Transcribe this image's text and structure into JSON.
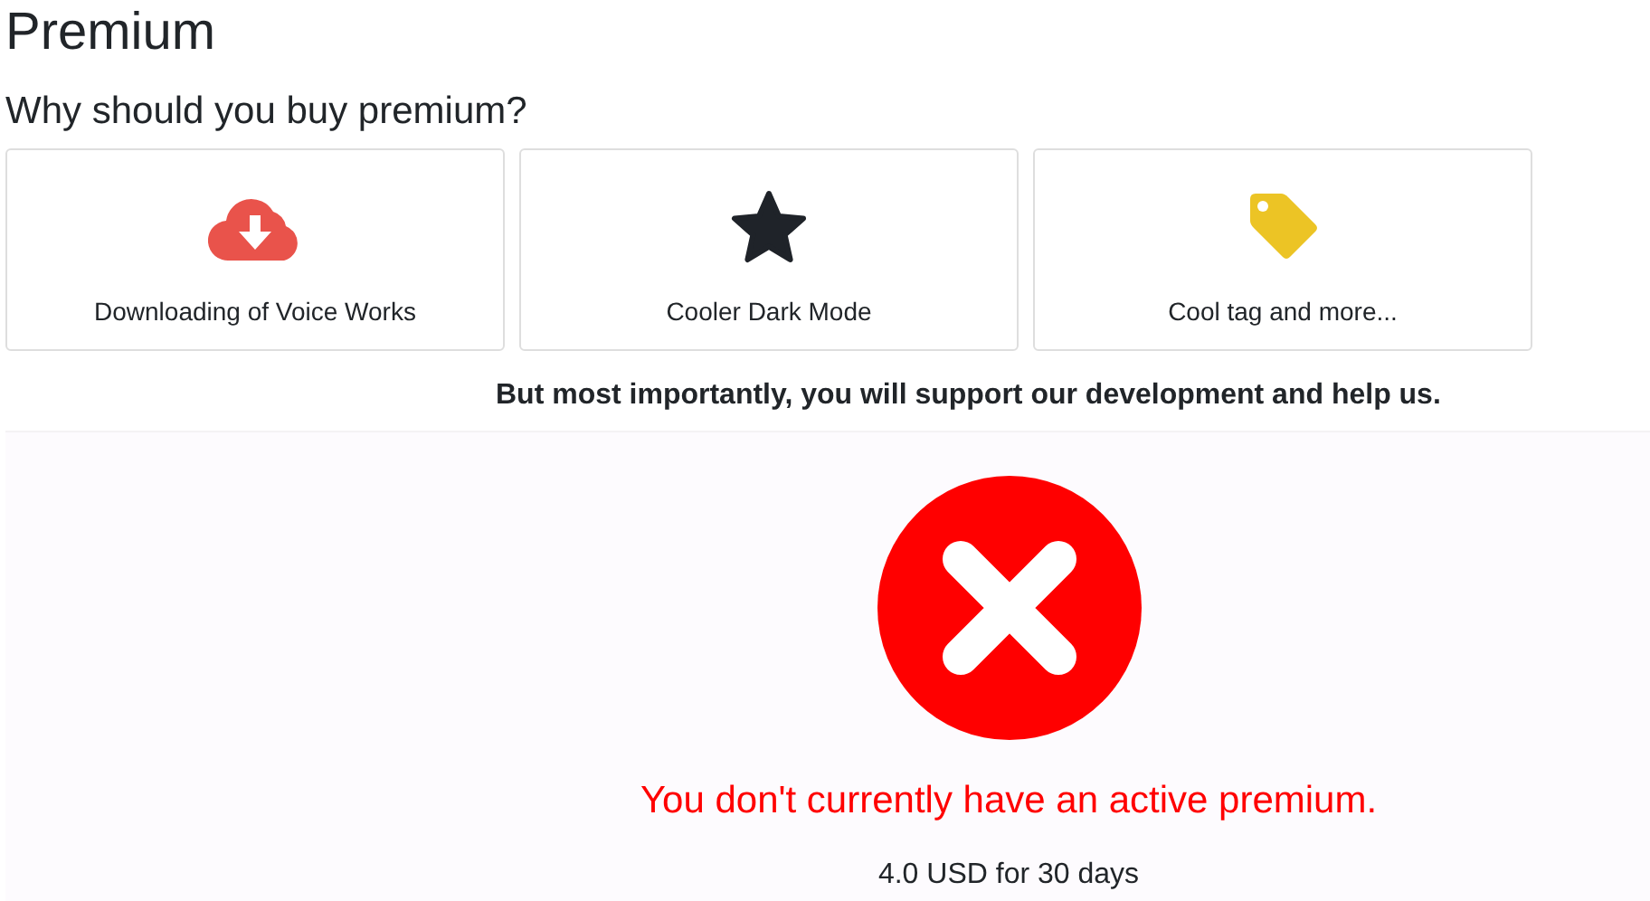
{
  "title": "Premium",
  "subtitle": "Why should you buy premium?",
  "features": [
    {
      "kind": "download",
      "label": "Downloading of Voice Works"
    },
    {
      "kind": "star",
      "label": "Cooler Dark Mode"
    },
    {
      "kind": "tag",
      "label": "Cool tag and more..."
    }
  ],
  "note": "But most importantly, you will support our development and help us.",
  "status": {
    "active": false,
    "message": "You don't currently have an active premium.",
    "price": "4.0 USD for 30 days"
  }
}
